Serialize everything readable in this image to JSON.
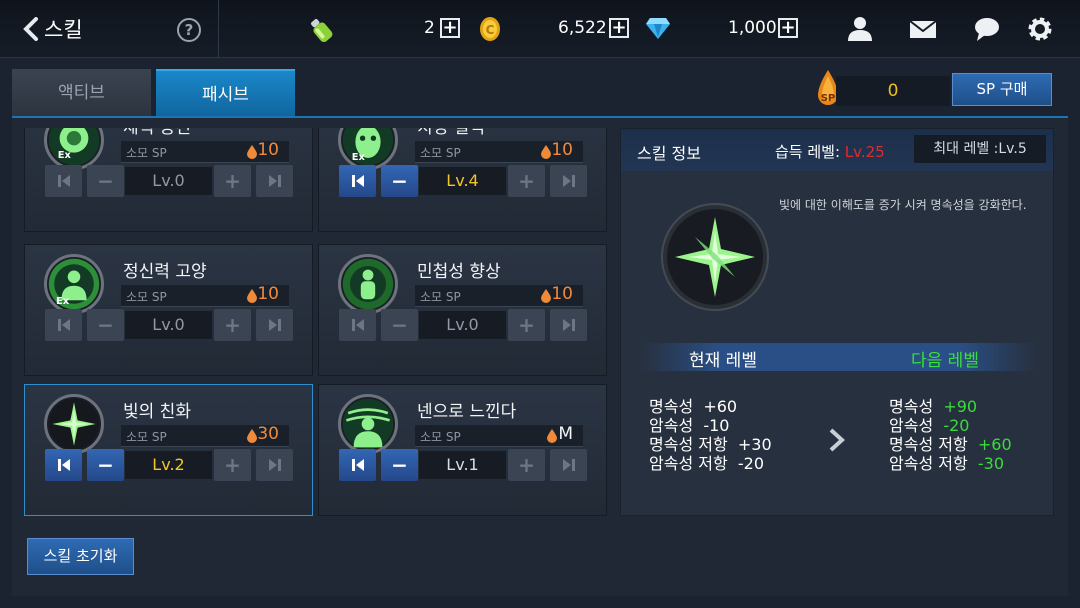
{
  "header": {
    "title": "스킬",
    "stamina_value": "2",
    "gold_value": "6,522",
    "gem_value": "1,000"
  },
  "tabs": [
    {
      "label": "액티브",
      "active": false
    },
    {
      "label": "패시브",
      "active": true
    }
  ],
  "sp": {
    "value": "0",
    "buy_label": "SP 구매"
  },
  "skills": [
    {
      "name": "체력 증진",
      "sp_label": "소모 SP",
      "sp_cost": "10",
      "level": "Lv.0",
      "active": false
    },
    {
      "name": "치명 일격",
      "sp_label": "소모 SP",
      "sp_cost": "10",
      "level": "Lv.4",
      "active": true
    },
    {
      "name": "정신력 고양",
      "sp_label": "소모 SP",
      "sp_cost": "10",
      "level": "Lv.0",
      "active": false
    },
    {
      "name": "민첩성 향상",
      "sp_label": "소모 SP",
      "sp_cost": "10",
      "level": "Lv.0",
      "active": false
    },
    {
      "name": "빛의 친화",
      "sp_label": "소모 SP",
      "sp_cost": "30",
      "level": "Lv.2",
      "active": true
    },
    {
      "name": "넨으로 느낀다",
      "sp_label": "소모 SP",
      "sp_cost": "M",
      "level": "Lv.1",
      "active": true
    }
  ],
  "info": {
    "title": "스킬 정보",
    "learn_label": "습득 레벨: ",
    "learn_level": "Lv.25",
    "max_level": "최대 레벨 :Lv.5",
    "description": "빛에 대한 이해도를 증가 시켜 명속성을 강화한다.",
    "current_label": "현재 레벨",
    "next_label": "다음 레벨",
    "current_stats": [
      {
        "name": "명속성",
        "value": "+60"
      },
      {
        "name": "암속성",
        "value": "-10"
      },
      {
        "name": "명속성 저항",
        "value": "+30"
      },
      {
        "name": "암속성 저항",
        "value": "-20"
      }
    ],
    "next_stats": [
      {
        "name": "명속성",
        "value": "+90"
      },
      {
        "name": "암속성",
        "value": "-20"
      },
      {
        "name": "명속성 저항",
        "value": "+60"
      },
      {
        "name": "암속성 저항",
        "value": "-30"
      }
    ]
  },
  "reset_label": "스킬 초기화",
  "colors": {
    "accent": "#1b87c9",
    "sp_cost": "#f08a3a",
    "next_value": "#39dc39",
    "learn_level": "#e02b2b",
    "level_active": "#f3c627"
  }
}
